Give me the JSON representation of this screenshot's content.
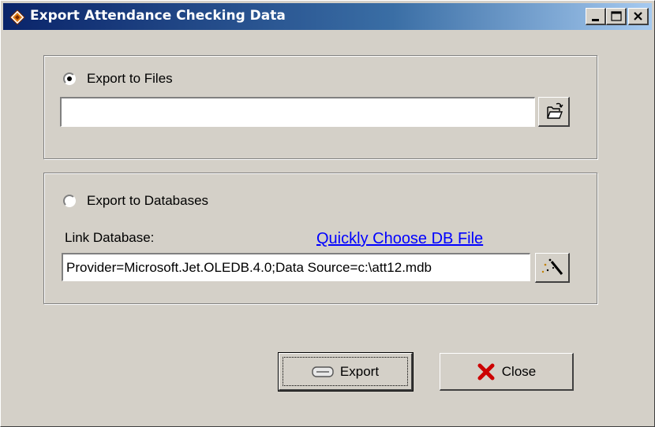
{
  "window": {
    "title": "Export Attendance Checking Data",
    "app_icon": "diamond-app-icon",
    "controls": {
      "minimize_icon": "minimize-icon",
      "maximize_icon": "maximize-icon",
      "close_icon": "close-icon"
    }
  },
  "files_group": {
    "radio_label": "Export to Files",
    "selected": true,
    "path_value": "",
    "browse_icon": "folder-open-icon"
  },
  "db_group": {
    "radio_label": "Export to Databases",
    "selected": false,
    "link_label": "Link Database:",
    "quick_link": "Quickly Choose DB File",
    "connection_value": "Provider=Microsoft.Jet.OLEDB.4.0;Data Source=c:\\att12.mdb",
    "wizard_icon": "magic-wand-icon"
  },
  "buttons": {
    "export_label": "Export",
    "export_icon": "export-icon",
    "close_label": "Close",
    "close_icon": "red-x-icon"
  },
  "colors": {
    "title_start": "#0a246a",
    "title_end": "#a6caf0",
    "face": "#d4d0c8",
    "link": "#0000ff",
    "close_x": "#cc0000"
  }
}
